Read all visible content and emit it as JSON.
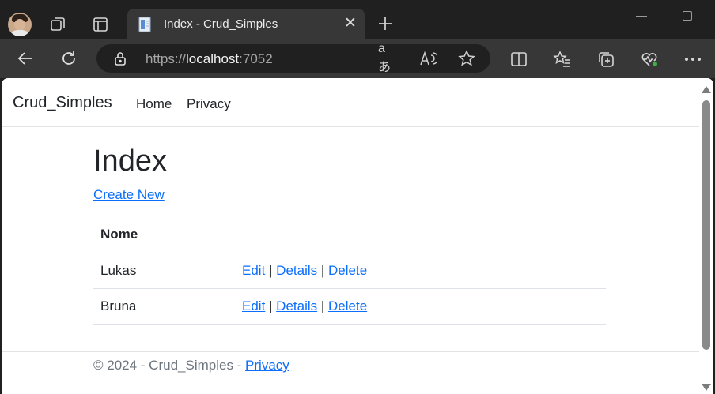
{
  "browser": {
    "tab_title": "Index - Crud_Simples",
    "url_scheme": "https://",
    "url_host": "localhost",
    "url_port": ":7052"
  },
  "navbar": {
    "brand": "Crud_Simples",
    "links": [
      "Home",
      "Privacy"
    ]
  },
  "main": {
    "heading": "Index",
    "create_link": "Create New",
    "table": {
      "headers": [
        "Nome",
        ""
      ],
      "rows": [
        {
          "nome": "Lukas",
          "actions": [
            "Edit",
            "Details",
            "Delete"
          ]
        },
        {
          "nome": "Bruna",
          "actions": [
            "Edit",
            "Details",
            "Delete"
          ]
        }
      ],
      "separator": " | "
    }
  },
  "footer": {
    "prefix": "© 2024 - Crud_Simples - ",
    "privacy_link": "Privacy"
  },
  "colors": {
    "link": "#0d6efd",
    "text": "#212529",
    "muted": "#6c757d",
    "chrome_dark": "#202020",
    "chrome_mid": "#373737"
  },
  "icons": [
    "profile-avatar",
    "workspaces-icon",
    "tab-actions-icon",
    "page-favicon",
    "close-icon",
    "plus-icon",
    "back-arrow-icon",
    "refresh-icon",
    "lock-icon",
    "read-aloud-translate-icon",
    "read-aloud-icon",
    "favorite-star-icon",
    "split-screen-icon",
    "favorites-list-icon",
    "collections-icon",
    "browser-health-icon",
    "more-menu-icon"
  ]
}
